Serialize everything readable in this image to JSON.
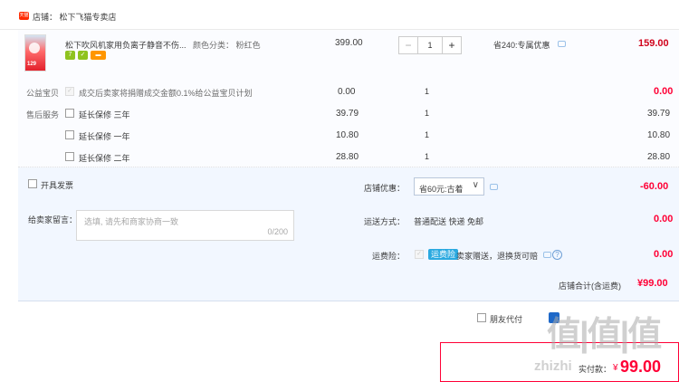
{
  "shop": {
    "tag": "天猫",
    "label": "店铺：",
    "name": "松下飞猫专卖店"
  },
  "product": {
    "thumb_text": "129",
    "title": "松下吹风机家用负离子静音不伤...",
    "color_label": "颜色分类：",
    "color_value": "粉红色",
    "unit_price": "399.00",
    "quantity": "1",
    "minus": "−",
    "plus": "+",
    "discount_text": "省240:专属优惠",
    "total": "159.00",
    "badges": [
      {
        "name": "seven-day-return-icon",
        "text": "7",
        "color": "#8fc31f"
      },
      {
        "name": "guarantee-icon",
        "text": "✓",
        "color": "#8fc31f"
      },
      {
        "name": "credit-card-icon",
        "text": "▬",
        "color": "#ff9600"
      }
    ]
  },
  "charity": {
    "label": "公益宝贝",
    "check_mark": "✓",
    "text": "成交后卖家将捐赠成交金额0.1%给公益宝贝计划",
    "price": "0.00",
    "quantity": "1",
    "total": "0.00"
  },
  "after_sale": {
    "label": "售后服务",
    "rows": [
      {
        "name": "延长保修 三年",
        "price": "39.79",
        "quantity": "1",
        "total": "39.79"
      },
      {
        "name": "延长保修 一年",
        "price": "10.80",
        "quantity": "1",
        "total": "10.80"
      },
      {
        "name": "延长保修 二年",
        "price": "28.80",
        "quantity": "1",
        "total": "28.80"
      }
    ]
  },
  "invoice": {
    "label": "开具发票"
  },
  "message": {
    "label": "给卖家留言：",
    "placeholder": "选填, 请先和商家协商一致",
    "counter": "0/200"
  },
  "coupon": {
    "label": "店铺优惠：",
    "value": "省60元:古着",
    "amount": "-60.00"
  },
  "shipping": {
    "label": "运送方式：",
    "value": "普通配送 快递 免邮",
    "amount": "0.00"
  },
  "insurance": {
    "label": "运费险：",
    "check_mark": "✓",
    "tag": "运费险",
    "text": "卖家赠送，退换货可赔",
    "help": "?",
    "amount": "0.00"
  },
  "shop_total": {
    "label": "店铺合计(含运费)",
    "amount": "¥99.00"
  },
  "friend_pay": {
    "label": "朋友代付"
  },
  "payable": {
    "label": "实付款：",
    "amount": "99.00",
    "currency": "¥"
  },
  "watermark": {
    "logo": "值|值|值",
    "url": "zhizhi"
  },
  "colors": {
    "accent_red": "#ff0036",
    "price_red": "#d0021b",
    "light_blue_bg": "#f2f7ff"
  }
}
